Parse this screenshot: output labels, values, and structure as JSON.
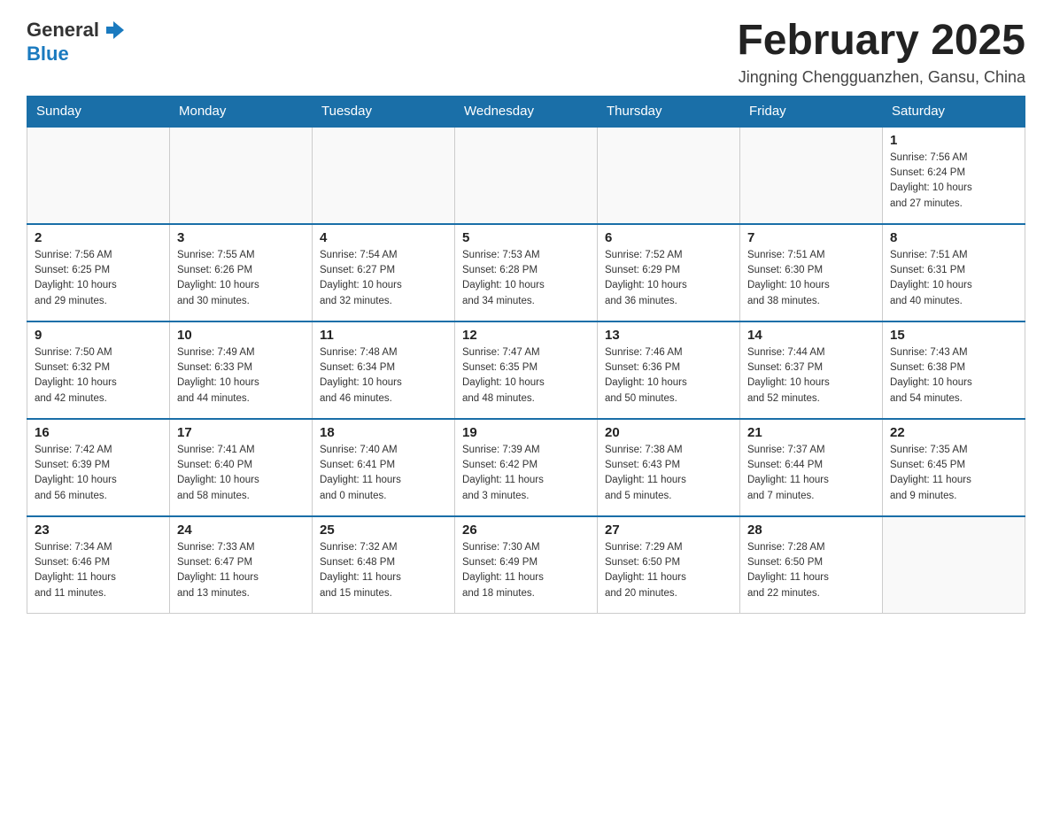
{
  "header": {
    "logo_general": "General",
    "logo_blue": "Blue",
    "month_title": "February 2025",
    "location": "Jingning Chengguanzhen, Gansu, China"
  },
  "weekdays": [
    "Sunday",
    "Monday",
    "Tuesday",
    "Wednesday",
    "Thursday",
    "Friday",
    "Saturday"
  ],
  "weeks": [
    [
      {
        "day": "",
        "info": ""
      },
      {
        "day": "",
        "info": ""
      },
      {
        "day": "",
        "info": ""
      },
      {
        "day": "",
        "info": ""
      },
      {
        "day": "",
        "info": ""
      },
      {
        "day": "",
        "info": ""
      },
      {
        "day": "1",
        "info": "Sunrise: 7:56 AM\nSunset: 6:24 PM\nDaylight: 10 hours\nand 27 minutes."
      }
    ],
    [
      {
        "day": "2",
        "info": "Sunrise: 7:56 AM\nSunset: 6:25 PM\nDaylight: 10 hours\nand 29 minutes."
      },
      {
        "day": "3",
        "info": "Sunrise: 7:55 AM\nSunset: 6:26 PM\nDaylight: 10 hours\nand 30 minutes."
      },
      {
        "day": "4",
        "info": "Sunrise: 7:54 AM\nSunset: 6:27 PM\nDaylight: 10 hours\nand 32 minutes."
      },
      {
        "day": "5",
        "info": "Sunrise: 7:53 AM\nSunset: 6:28 PM\nDaylight: 10 hours\nand 34 minutes."
      },
      {
        "day": "6",
        "info": "Sunrise: 7:52 AM\nSunset: 6:29 PM\nDaylight: 10 hours\nand 36 minutes."
      },
      {
        "day": "7",
        "info": "Sunrise: 7:51 AM\nSunset: 6:30 PM\nDaylight: 10 hours\nand 38 minutes."
      },
      {
        "day": "8",
        "info": "Sunrise: 7:51 AM\nSunset: 6:31 PM\nDaylight: 10 hours\nand 40 minutes."
      }
    ],
    [
      {
        "day": "9",
        "info": "Sunrise: 7:50 AM\nSunset: 6:32 PM\nDaylight: 10 hours\nand 42 minutes."
      },
      {
        "day": "10",
        "info": "Sunrise: 7:49 AM\nSunset: 6:33 PM\nDaylight: 10 hours\nand 44 minutes."
      },
      {
        "day": "11",
        "info": "Sunrise: 7:48 AM\nSunset: 6:34 PM\nDaylight: 10 hours\nand 46 minutes."
      },
      {
        "day": "12",
        "info": "Sunrise: 7:47 AM\nSunset: 6:35 PM\nDaylight: 10 hours\nand 48 minutes."
      },
      {
        "day": "13",
        "info": "Sunrise: 7:46 AM\nSunset: 6:36 PM\nDaylight: 10 hours\nand 50 minutes."
      },
      {
        "day": "14",
        "info": "Sunrise: 7:44 AM\nSunset: 6:37 PM\nDaylight: 10 hours\nand 52 minutes."
      },
      {
        "day": "15",
        "info": "Sunrise: 7:43 AM\nSunset: 6:38 PM\nDaylight: 10 hours\nand 54 minutes."
      }
    ],
    [
      {
        "day": "16",
        "info": "Sunrise: 7:42 AM\nSunset: 6:39 PM\nDaylight: 10 hours\nand 56 minutes."
      },
      {
        "day": "17",
        "info": "Sunrise: 7:41 AM\nSunset: 6:40 PM\nDaylight: 10 hours\nand 58 minutes."
      },
      {
        "day": "18",
        "info": "Sunrise: 7:40 AM\nSunset: 6:41 PM\nDaylight: 11 hours\nand 0 minutes."
      },
      {
        "day": "19",
        "info": "Sunrise: 7:39 AM\nSunset: 6:42 PM\nDaylight: 11 hours\nand 3 minutes."
      },
      {
        "day": "20",
        "info": "Sunrise: 7:38 AM\nSunset: 6:43 PM\nDaylight: 11 hours\nand 5 minutes."
      },
      {
        "day": "21",
        "info": "Sunrise: 7:37 AM\nSunset: 6:44 PM\nDaylight: 11 hours\nand 7 minutes."
      },
      {
        "day": "22",
        "info": "Sunrise: 7:35 AM\nSunset: 6:45 PM\nDaylight: 11 hours\nand 9 minutes."
      }
    ],
    [
      {
        "day": "23",
        "info": "Sunrise: 7:34 AM\nSunset: 6:46 PM\nDaylight: 11 hours\nand 11 minutes."
      },
      {
        "day": "24",
        "info": "Sunrise: 7:33 AM\nSunset: 6:47 PM\nDaylight: 11 hours\nand 13 minutes."
      },
      {
        "day": "25",
        "info": "Sunrise: 7:32 AM\nSunset: 6:48 PM\nDaylight: 11 hours\nand 15 minutes."
      },
      {
        "day": "26",
        "info": "Sunrise: 7:30 AM\nSunset: 6:49 PM\nDaylight: 11 hours\nand 18 minutes."
      },
      {
        "day": "27",
        "info": "Sunrise: 7:29 AM\nSunset: 6:50 PM\nDaylight: 11 hours\nand 20 minutes."
      },
      {
        "day": "28",
        "info": "Sunrise: 7:28 AM\nSunset: 6:50 PM\nDaylight: 11 hours\nand 22 minutes."
      },
      {
        "day": "",
        "info": ""
      }
    ]
  ]
}
